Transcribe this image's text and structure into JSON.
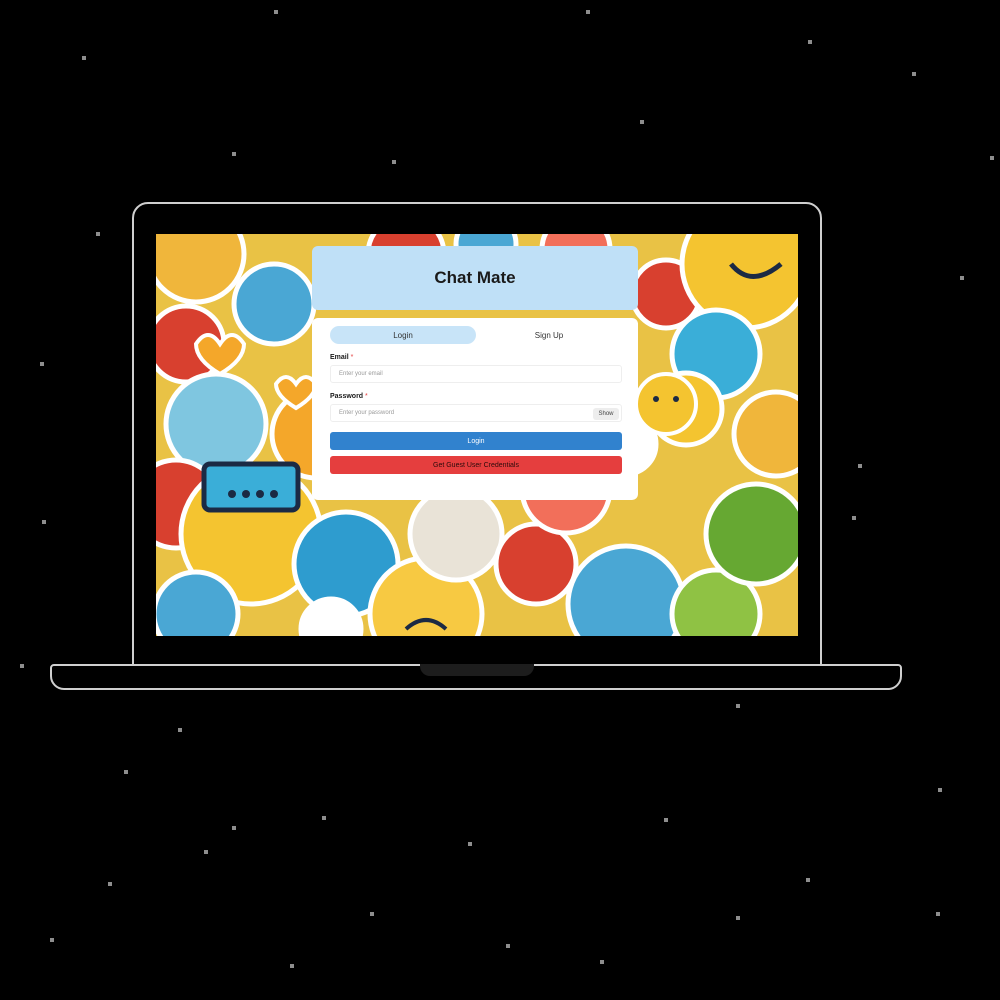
{
  "app": {
    "title": "Chat Mate"
  },
  "auth": {
    "tabs": [
      {
        "label": "Login",
        "active": true
      },
      {
        "label": "Sign Up",
        "active": false
      }
    ],
    "email": {
      "label": "Email",
      "required_mark": "*",
      "placeholder": "Enter your email"
    },
    "password": {
      "label": "Password",
      "required_mark": "*",
      "placeholder": "Enter your password",
      "toggle_label": "Show"
    },
    "login_button": "Login",
    "guest_button": "Get Guest User Credentials"
  },
  "colors": {
    "header_bg": "#bfe0f7",
    "tab_active_bg": "#c8e4f8",
    "login_button": "#3182ce",
    "guest_button": "#e53e3e"
  }
}
